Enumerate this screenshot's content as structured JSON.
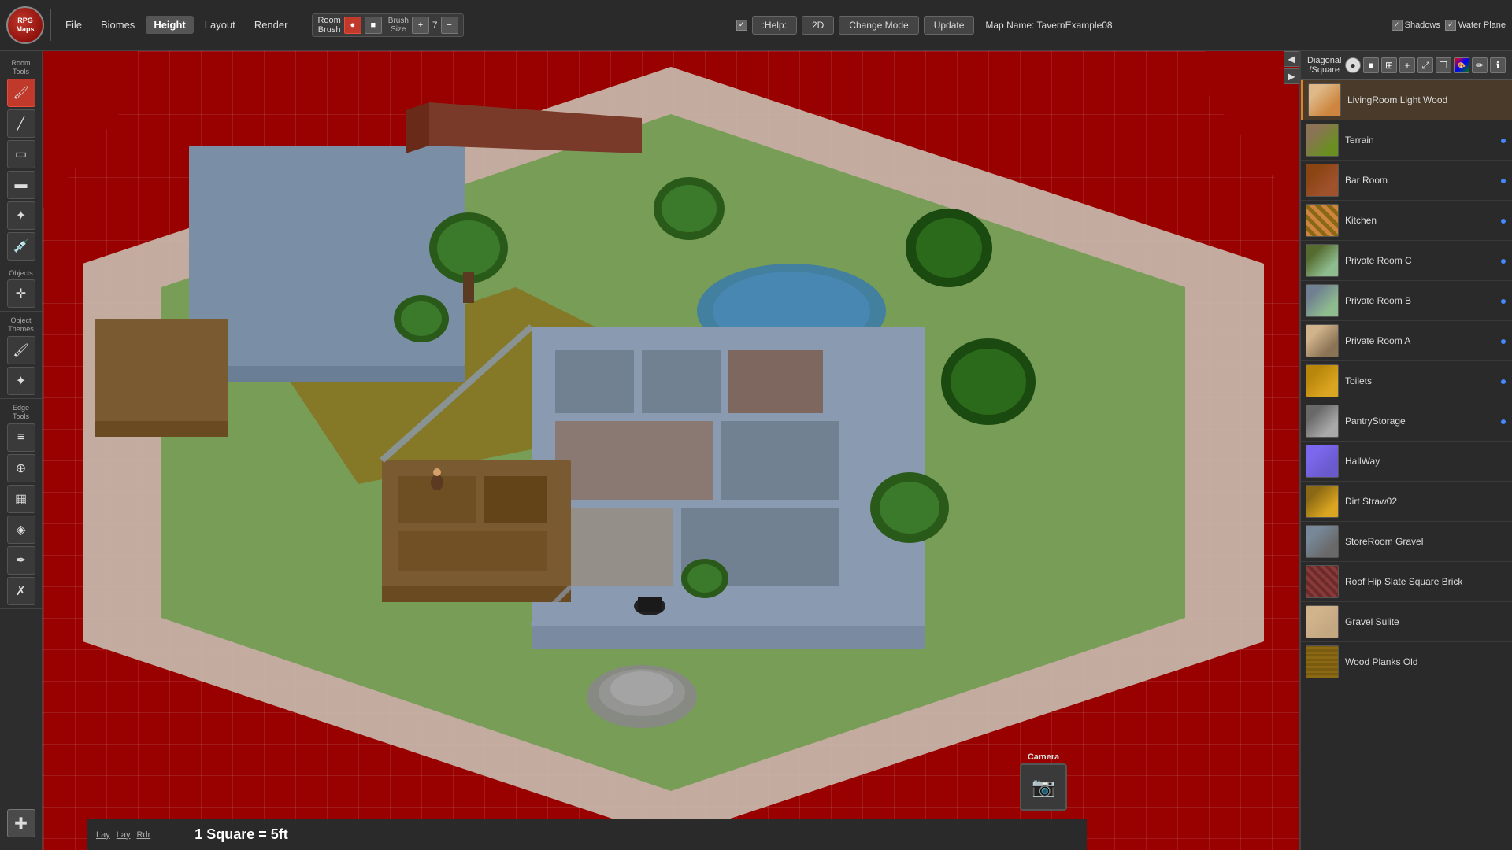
{
  "app": {
    "logo_text": "RPG\nMaps",
    "title": "RPG Maps"
  },
  "menubar": {
    "items": [
      {
        "id": "file",
        "label": "File",
        "active": false
      },
      {
        "id": "biomes",
        "label": "Biomes",
        "active": false
      },
      {
        "id": "height",
        "label": "Height",
        "active": true
      },
      {
        "id": "layout",
        "label": "Layout",
        "active": false
      },
      {
        "id": "render",
        "label": "Render",
        "active": false
      }
    ],
    "room_brush_label1": "Room",
    "room_brush_label2": "Brush",
    "brush_size_label": "Brush\nSize",
    "brush_size_value": "7",
    "center_buttons": [
      {
        "id": "help",
        "label": ":Help:"
      },
      {
        "id": "2d",
        "label": "2D"
      },
      {
        "id": "change-mode",
        "label": "Change Mode"
      },
      {
        "id": "update",
        "label": "Update"
      }
    ],
    "map_name_label": "Map Name:",
    "map_name": "TavernExample08",
    "shadows_label": "Shadows",
    "water_plane_label": "Water Plane"
  },
  "left_sidebar": {
    "sections": [
      {
        "id": "room-tools",
        "label": "Room\nTools",
        "tools": [
          {
            "id": "paint",
            "icon": "🎨",
            "active": true
          },
          {
            "id": "line",
            "icon": "╱"
          },
          {
            "id": "rect",
            "icon": "▭"
          },
          {
            "id": "rect-fill",
            "icon": "▬"
          },
          {
            "id": "pick",
            "icon": "✦"
          },
          {
            "id": "eyedropper",
            "icon": "💉"
          }
        ]
      },
      {
        "id": "objects",
        "label": "Objects",
        "tools": [
          {
            "id": "obj-select",
            "icon": "⊹"
          }
        ]
      },
      {
        "id": "object-themes",
        "label": "Object\nThemes",
        "tools": [
          {
            "id": "theme-paint",
            "icon": "🖌"
          },
          {
            "id": "theme-pick",
            "icon": "✦"
          }
        ]
      },
      {
        "id": "edge-tools",
        "label": "Edge\nTools",
        "tools": [
          {
            "id": "edge1",
            "icon": "≡"
          },
          {
            "id": "edge2",
            "icon": "⊕"
          },
          {
            "id": "edge3",
            "icon": "▦"
          },
          {
            "id": "edge4",
            "icon": "◈"
          },
          {
            "id": "edge5",
            "icon": "✒"
          },
          {
            "id": "edge6",
            "icon": "✗"
          }
        ]
      },
      {
        "id": "add",
        "label": "",
        "tools": [
          {
            "id": "add-tool",
            "icon": "✚"
          }
        ]
      }
    ]
  },
  "right_sidebar": {
    "diagonal_square_label": "Diagonal\n/Square",
    "layers": [
      {
        "id": "livingroom",
        "name": "LivingRoom Light Wood",
        "thumb": "thumb-livingroom",
        "active": true
      },
      {
        "id": "terrain",
        "name": "Terrain",
        "thumb": "thumb-terrain",
        "dot": "blue"
      },
      {
        "id": "bar-room",
        "name": "Bar Room",
        "thumb": "thumb-bar-room",
        "dot": "blue"
      },
      {
        "id": "kitchen",
        "name": "Kitchen",
        "thumb": "thumb-kitchen",
        "dot": "blue"
      },
      {
        "id": "private-c",
        "name": "Private Room C",
        "thumb": "thumb-private-c",
        "dot": "blue"
      },
      {
        "id": "private-b",
        "name": "Private Room B",
        "thumb": "thumb-private-b",
        "dot": "blue"
      },
      {
        "id": "private-a",
        "name": "Private Room A",
        "thumb": "thumb-private-a",
        "dot": "blue"
      },
      {
        "id": "toilets",
        "name": "Toilets",
        "thumb": "thumb-toilets",
        "dot": "blue"
      },
      {
        "id": "pantry",
        "name": "PantryStorage",
        "thumb": "thumb-pantry",
        "dot": "blue"
      },
      {
        "id": "hallway",
        "name": "HallWay",
        "thumb": "thumb-hallway"
      },
      {
        "id": "dirt",
        "name": "Dirt Straw02",
        "thumb": "thumb-dirt"
      },
      {
        "id": "storeroom",
        "name": "StoreRoom Gravel",
        "thumb": "thumb-storeroom"
      },
      {
        "id": "roof",
        "name": "Roof Hip Slate Square Brick",
        "thumb": "thumb-roof"
      },
      {
        "id": "gravel",
        "name": "Gravel Sulite",
        "thumb": "thumb-gravel"
      },
      {
        "id": "wood",
        "name": "Wood Planks Old",
        "thumb": "thumb-wood"
      }
    ]
  },
  "statusbar": {
    "tabs": [
      "Lay",
      "Lay",
      "Rdr"
    ],
    "scale": "1 Square = 5ft"
  },
  "camera_widget": {
    "label": "Camera",
    "icon": "📷"
  },
  "nav_arrows": {
    "left": "◀",
    "right": "▶"
  }
}
